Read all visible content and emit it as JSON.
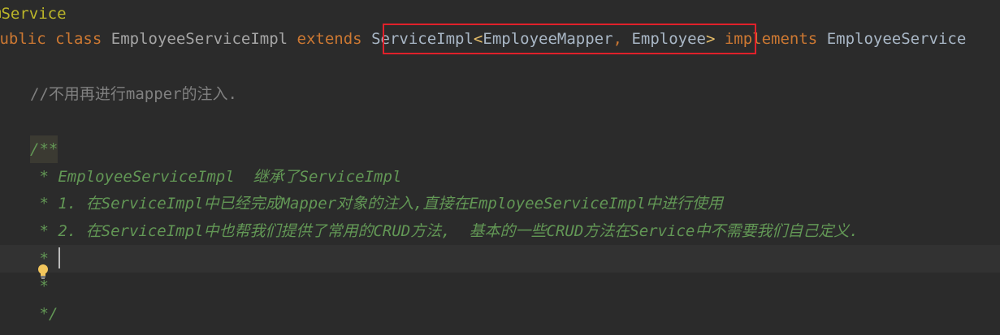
{
  "editor": {
    "lines": {
      "annotation": "@Service",
      "class_decl": {
        "kw_public": "public",
        "kw_class": "class",
        "class_name": "EmployeeServiceImpl",
        "kw_extends": "extends",
        "super_type": "ServiceImpl",
        "lt": "<",
        "type_arg1": "EmployeeMapper",
        "comma": ",",
        "type_arg2": "Employee",
        "gt": ">",
        "kw_implements": "implements",
        "interface_name": "EmployeeService"
      },
      "line_comment": "//不用再进行mapper的注入.",
      "doc_open": "/**",
      "doc_line1": " * EmployeeServiceImpl  继承了ServiceImpl",
      "doc_line2": " * 1. 在ServiceImpl中已经完成Mapper对象的注入,直接在EmployeeServiceImpl中进行使用",
      "doc_line3": " * 2. 在ServiceImpl中也帮我们提供了常用的CRUD方法,  基本的一些CRUD方法在Service中不需要我们自己定义.",
      "doc_line4": " *",
      "doc_line5": " *",
      "doc_close": " */"
    },
    "icons": {
      "intention_bulb": "lightbulb-icon"
    },
    "colors": {
      "background": "#2b2b2b",
      "keyword": "#cc7832",
      "annotation": "#bbb529",
      "doc_comment": "#629755",
      "line_comment": "#808080",
      "highlight_box": "#e0202a"
    }
  }
}
